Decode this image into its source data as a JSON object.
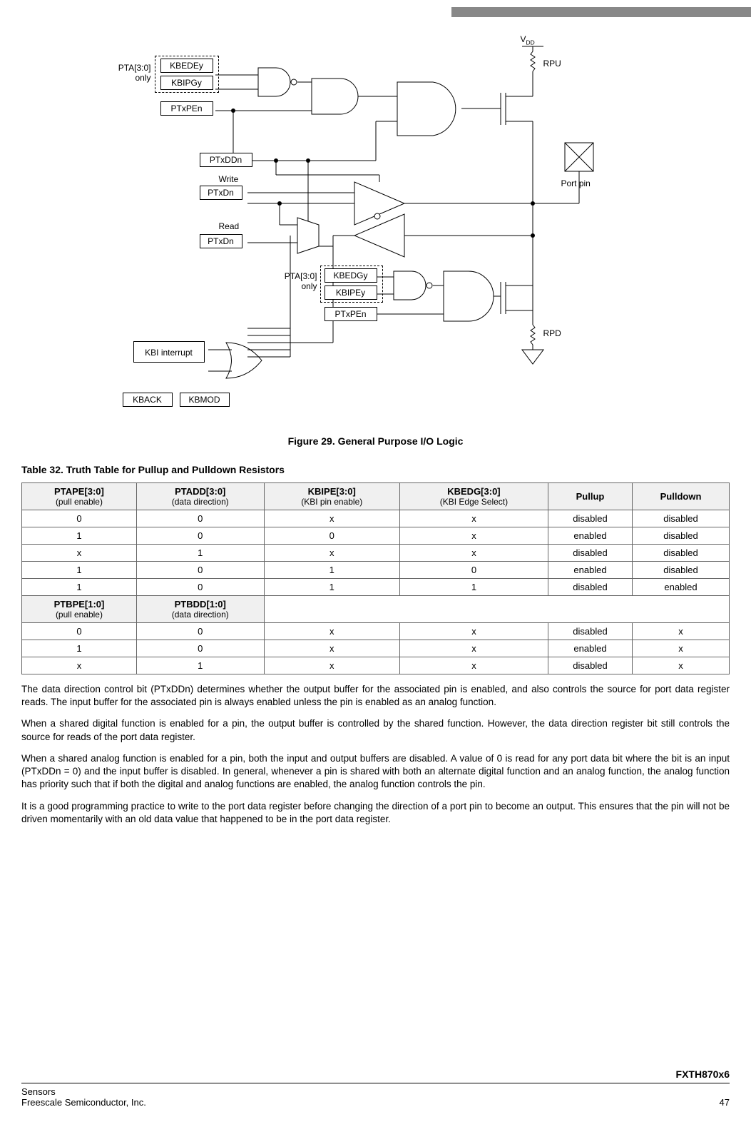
{
  "topbar": {},
  "diagram": {
    "pta_upper": "PTA[3:0]",
    "only_upper": "only",
    "kbedey": "KBEDEy",
    "kbipgy": "KBIPGy",
    "ptxpen_upper": "PTxPEn",
    "ptxddn": "PTxDDn",
    "write": "Write",
    "ptxdn_write": "PTxDn",
    "read": "Read",
    "ptxdn_read": "PTxDn",
    "pta_lower": "PTA[3:0]",
    "only_lower": "only",
    "kbedgy": "KBEDGy",
    "kbipey": "KBIPEy",
    "ptxpen_lower": "PTxPEn",
    "kbi_interrupt": "KBI interrupt",
    "kback": "KBACK",
    "kbmod": "KBMOD",
    "vdd": "VDD",
    "rpu": "RPU",
    "rpd": "RPD",
    "port_pin": "Port pin"
  },
  "figure_caption": "Figure 29. General Purpose I/O Logic",
  "table_title": "Table 32. Truth Table for Pullup and Pulldown Resistors",
  "table": {
    "headers": [
      {
        "main": "PTAPE[3:0]",
        "sub": "(pull enable)"
      },
      {
        "main": "PTADD[3:0]",
        "sub": "(data direction)"
      },
      {
        "main": "KBIPE[3:0]",
        "sub": "(KBI pin enable)"
      },
      {
        "main": "KBEDG[3:0]",
        "sub": "(KBI Edge Select)"
      },
      {
        "main": "Pullup",
        "sub": ""
      },
      {
        "main": "Pulldown",
        "sub": ""
      }
    ],
    "rowsA": [
      [
        "0",
        "0",
        "x",
        "x",
        "disabled",
        "disabled"
      ],
      [
        "1",
        "0",
        "0",
        "x",
        "enabled",
        "disabled"
      ],
      [
        "x",
        "1",
        "x",
        "x",
        "disabled",
        "disabled"
      ],
      [
        "1",
        "0",
        "1",
        "0",
        "enabled",
        "disabled"
      ],
      [
        "1",
        "0",
        "1",
        "1",
        "disabled",
        "enabled"
      ]
    ],
    "sub_headers": [
      {
        "main": "PTBPE[1:0]",
        "sub": "(pull enable)"
      },
      {
        "main": "PTBDD[1:0]",
        "sub": "(data direction)"
      }
    ],
    "rowsB": [
      [
        "0",
        "0",
        "x",
        "x",
        "disabled",
        "x"
      ],
      [
        "1",
        "0",
        "x",
        "x",
        "enabled",
        "x"
      ],
      [
        "x",
        "1",
        "x",
        "x",
        "disabled",
        "x"
      ]
    ]
  },
  "paragraphs": [
    "The data direction control bit (PTxDDn) determines whether the output buffer for the associated pin is enabled, and also controls the source for port data register reads. The input buffer for the associated pin is always enabled unless the pin is enabled as an analog function.",
    "When a shared digital function is enabled for a pin, the output buffer is controlled by the shared function. However, the data direction register bit still controls the source for reads of the port data register.",
    "When a shared analog function is enabled for a pin, both the input and output buffers are disabled. A value of 0 is read for any port data bit where the bit is an input (PTxDDn = 0) and the input buffer is disabled. In general, whenever a pin is shared with both an alternate digital function and an analog function, the analog function has priority such that if both the digital and analog functions are enabled, the analog function controls the pin.",
    "It is a good programming practice to write to the port data register before changing the direction of a port pin to become an output. This ensures that the pin will not be driven momentarily with an old data value that happened to be in the port data register."
  ],
  "footer": {
    "product": "FXTH870x6",
    "left1": "Sensors",
    "left2": "Freescale Semiconductor, Inc.",
    "page": "47"
  }
}
